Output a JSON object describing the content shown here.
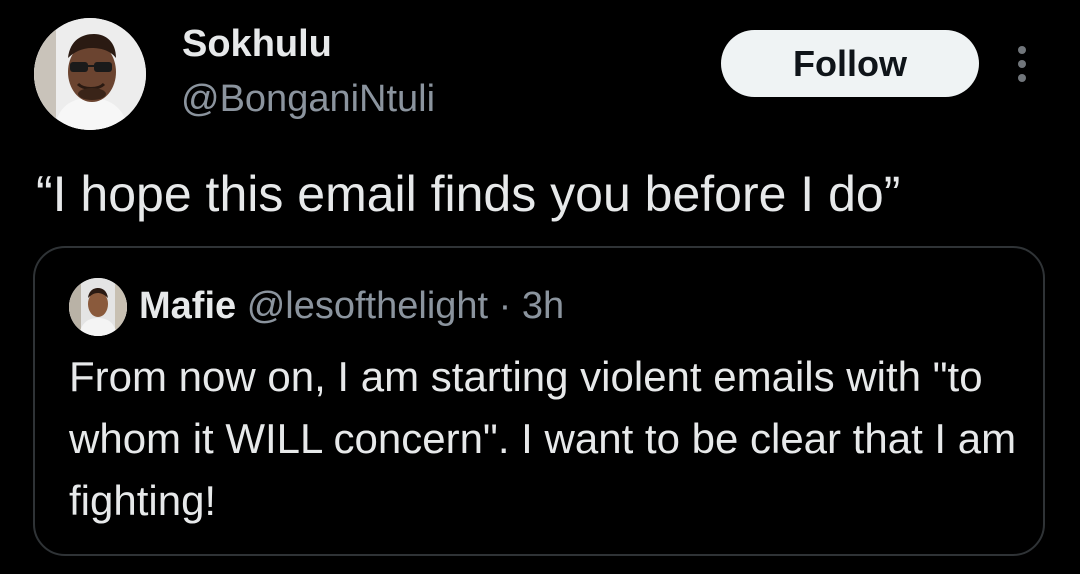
{
  "tweet": {
    "author": {
      "display_name": "Sokhulu",
      "handle": "@BonganiNtuli"
    },
    "follow_label": "Follow",
    "more_icon": "more-vertical-icon",
    "text": "“I hope this email finds you before I do”"
  },
  "quoted_tweet": {
    "author": {
      "display_name": "Mafie",
      "handle": "@lesofthelight"
    },
    "separator": "·",
    "time": "3h",
    "text": "From now on, I am starting violent emails with \"to whom it WILL concern\". I want to be clear that I am fighting!"
  },
  "colors": {
    "background": "#000000",
    "text_primary": "#e7e9ea",
    "text_secondary": "#8b949e",
    "border": "#2f3336",
    "follow_button_bg": "#eff3f4",
    "follow_button_text": "#0f1419"
  }
}
